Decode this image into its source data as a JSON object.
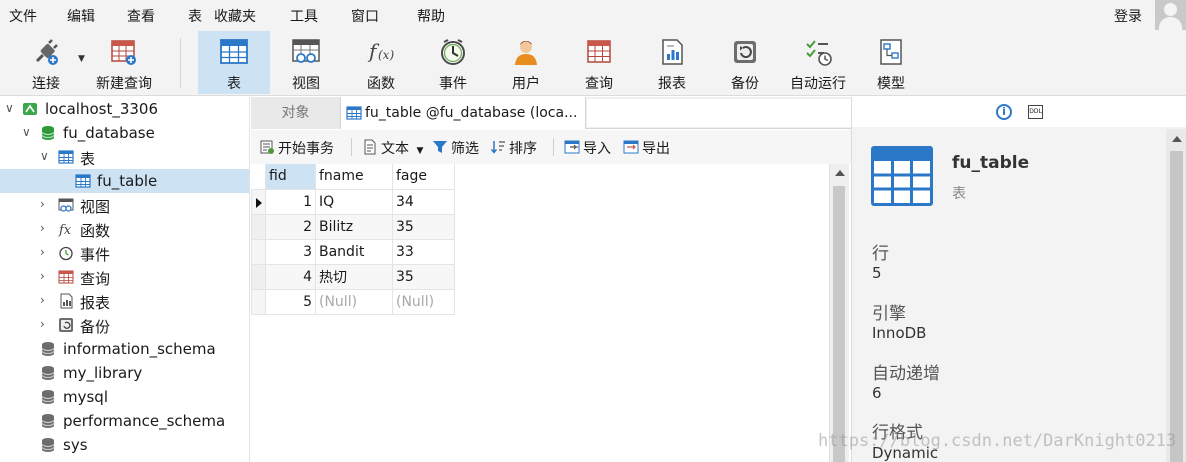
{
  "menu": {
    "items": [
      "文件",
      "编辑",
      "查看",
      "表",
      "收藏夹",
      "工具",
      "窗口",
      "帮助"
    ],
    "login": "登录"
  },
  "toolbar": {
    "items": [
      {
        "label": "连接",
        "icon": "plug-connection-icon"
      },
      {
        "label": "新建查询",
        "icon": "new-query-icon"
      },
      {
        "label": "表",
        "icon": "table-icon",
        "active": true
      },
      {
        "label": "视图",
        "icon": "view-icon"
      },
      {
        "label": "函数",
        "icon": "function-icon"
      },
      {
        "label": "事件",
        "icon": "clock-event-icon"
      },
      {
        "label": "用户",
        "icon": "user-icon"
      },
      {
        "label": "查询",
        "icon": "query-icon"
      },
      {
        "label": "报表",
        "icon": "report-icon"
      },
      {
        "label": "备份",
        "icon": "backup-icon"
      },
      {
        "label": "自动运行",
        "icon": "automation-icon"
      },
      {
        "label": "模型",
        "icon": "model-icon"
      }
    ]
  },
  "tree": {
    "connection": "localhost_3306",
    "database": "fu_database",
    "tables_group": "表",
    "selected_table": "fu_table",
    "groups": [
      "视图",
      "函数",
      "事件",
      "查询",
      "报表",
      "备份"
    ],
    "other_databases": [
      "information_schema",
      "my_library",
      "mysql",
      "performance_schema",
      "sys"
    ]
  },
  "tabs": {
    "objects": "对象",
    "active": "fu_table @fu_database (loca..."
  },
  "data_toolbar": {
    "begin_transaction": "开始事务",
    "text": "文本",
    "filter": "筛选",
    "sort": "排序",
    "import": "导入",
    "export": "导出"
  },
  "grid": {
    "columns": [
      "fid",
      "fname",
      "fage"
    ],
    "rows": [
      [
        "1",
        "IQ",
        "34"
      ],
      [
        "2",
        "Bilitz",
        "35"
      ],
      [
        "3",
        "Bandit",
        "33"
      ],
      [
        "4",
        "热切",
        "35"
      ],
      [
        "5",
        "(Null)",
        "(Null)"
      ]
    ]
  },
  "info": {
    "title": "fu_table",
    "subtitle": "表",
    "rows_label": "行",
    "rows_value": "5",
    "engine_label": "引擎",
    "engine_value": "InnoDB",
    "autoinc_label": "自动递增",
    "autoinc_value": "6",
    "rowformat_label": "行格式",
    "rowformat_value": "Dynamic",
    "ddl_text": "DDL"
  },
  "watermark": "https://blog.csdn.net/DarKnight0213",
  "colors": {
    "accent": "#2b78c9",
    "selection": "#cde3f4",
    "database_green": "#2e9a3c"
  }
}
